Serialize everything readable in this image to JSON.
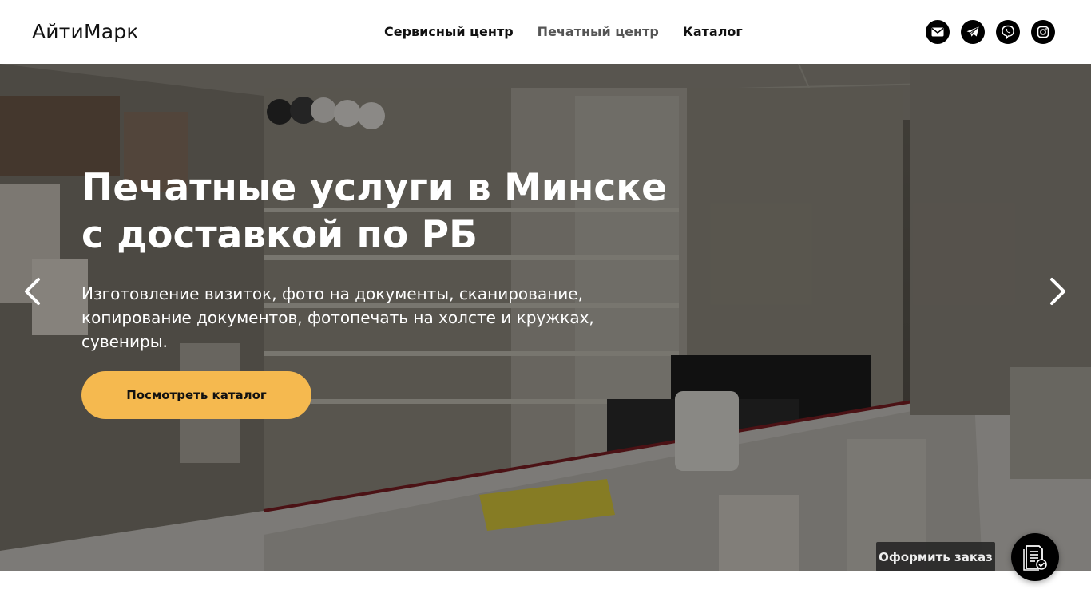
{
  "header": {
    "logo": "АйтиМарк",
    "nav": [
      {
        "label": "Сервисный центр"
      },
      {
        "label": "Печатный центр"
      },
      {
        "label": "Каталог"
      }
    ],
    "socials": [
      "mail-icon",
      "telegram-icon",
      "viber-icon",
      "instagram-icon"
    ]
  },
  "hero": {
    "title": "Печатные услуги в Минске с доставкой по РБ",
    "description": "Изготовление визиток, фото на документы, сканирование, копирование документов, фотопечать на холсте и кружках, сувениры.",
    "button_label": "Посмотреть каталог",
    "button_color": "#f5b94f"
  },
  "order_widget": {
    "label": "Оформить заказ",
    "icon": "order-document-icon"
  }
}
